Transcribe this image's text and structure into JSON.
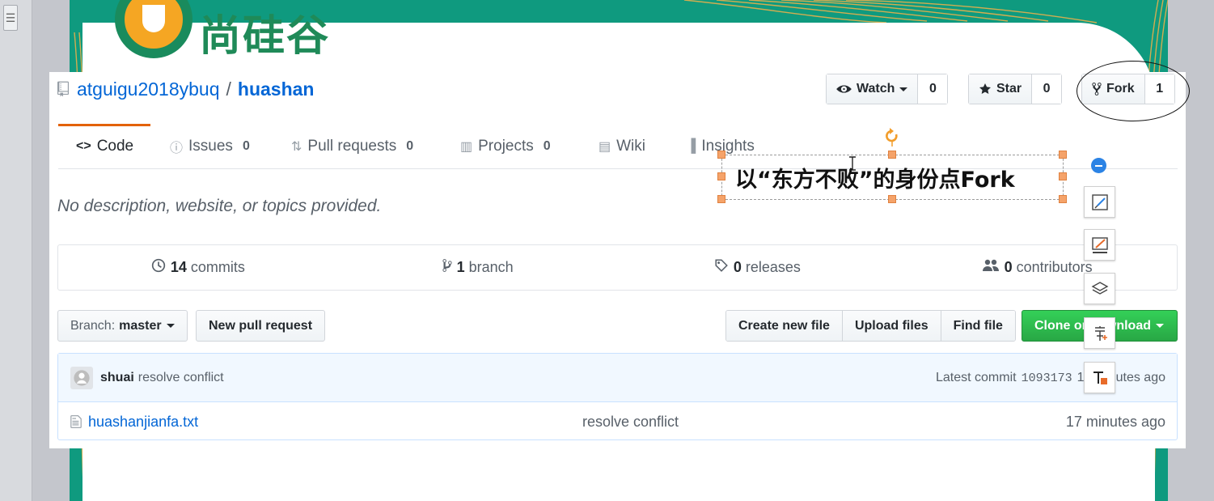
{
  "logo": {
    "text": "尚硅谷"
  },
  "repo": {
    "owner": "atguigu2018ybuq",
    "separator": "/",
    "name": "huashan"
  },
  "actions": [
    {
      "label": "Watch",
      "count": "0",
      "icon": "eye-icon",
      "has_caret": true
    },
    {
      "label": "Star",
      "count": "0",
      "icon": "star-icon"
    },
    {
      "label": "Fork",
      "count": "1",
      "icon": "fork-icon"
    }
  ],
  "tabs": [
    {
      "label": "Code",
      "icon": "code-icon",
      "selected": true
    },
    {
      "label": "Issues",
      "icon": "issue-icon",
      "count": "0"
    },
    {
      "label": "Pull requests",
      "icon": "pull-request-icon",
      "count": "0"
    },
    {
      "label": "Projects",
      "icon": "project-icon",
      "count": "0"
    },
    {
      "label": "Wiki",
      "icon": "book-icon"
    },
    {
      "label": "Insights",
      "icon": "graph-icon"
    }
  ],
  "description": "No description, website, or topics provided.",
  "summary": [
    {
      "count": "14",
      "label": "commits",
      "icon": "history-icon"
    },
    {
      "count": "1",
      "label": "branch",
      "icon": "branch-icon"
    },
    {
      "count": "0",
      "label": "releases",
      "icon": "tag-icon"
    },
    {
      "count": "0",
      "label": "contributors",
      "icon": "people-icon"
    }
  ],
  "toolbar": {
    "branch_prefix": "Branch:",
    "branch_value": "master",
    "new_pull_request": "New pull request",
    "create_new_file": "Create new file",
    "upload_files": "Upload files",
    "find_file": "Find file",
    "clone_download": "Clone or download"
  },
  "latest_commit": {
    "author": "shuai",
    "message": "resolve conflict",
    "label": "Latest commit",
    "sha": "1093173",
    "age": "17 minutes ago"
  },
  "files": [
    {
      "name": "huashanjianfa.txt",
      "message": "resolve conflict",
      "age": "17 minutes ago",
      "icon": "file-icon"
    }
  ],
  "annotation": {
    "text": "以“东方不败”的身份点Fork"
  },
  "side_tools": [
    "collapse-icon",
    "edit-shape-icon",
    "edit-line-icon",
    "layers-icon",
    "text-style-icon",
    "text-fill-icon"
  ],
  "colors": {
    "link": "#0366d6",
    "accent_tab": "#e36209",
    "clone_green": "#28a745",
    "slide_teal": "#0f9a7f",
    "handle": "#f5a36a"
  }
}
